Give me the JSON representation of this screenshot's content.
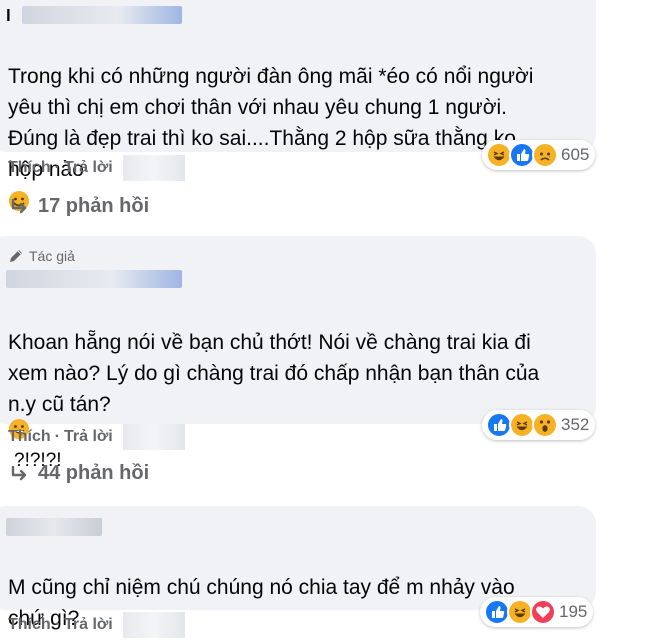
{
  "comments": [
    {
      "name_initial": "l",
      "text": "Trong khi có những người đàn ông mãi *éo có nổi người\nyêu thì chị em chơi thân với nhau yêu chung 1 người.\nĐúng là đẹp trai thì ko sai....Thằng 2 hộp sữa thằng ko\nhộp nào",
      "like_label": "Thích",
      "reply_label": "Trả lời",
      "reaction_count": "605",
      "reactions": [
        "haha",
        "like",
        "sad"
      ],
      "replies_label": "17 phản hồi"
    },
    {
      "author_badge": "Tác giả",
      "text": "Khoan hẵng nói về bạn chủ thớt! Nói về chàng trai kia đi\nxem nào? Lý do gì chàng trai đó chấp nhận bạn thân của\nn.y cũ tán?",
      "text_suffix": "?!?!?!",
      "like_label": "Thích",
      "reply_label": "Trả lời",
      "reaction_count": "352",
      "reactions": [
        "like",
        "haha",
        "wow"
      ],
      "replies_label": "44 phản hồi"
    },
    {
      "text": "M cũng chỉ niệm chú chúng nó chia tay để m nhảy vào\nchứ gì?",
      "like_label": "Thích",
      "reply_label": "Trả lời",
      "reaction_count": "195",
      "reactions": [
        "like",
        "haha",
        "love"
      ]
    }
  ],
  "separator": "·",
  "colors": {
    "bubble": "#f0f2f5",
    "secondary_text": "#65676b",
    "like_blue": "#1877f2",
    "love_red": "#f33e58",
    "emoji_yellow": "#f7b125"
  }
}
